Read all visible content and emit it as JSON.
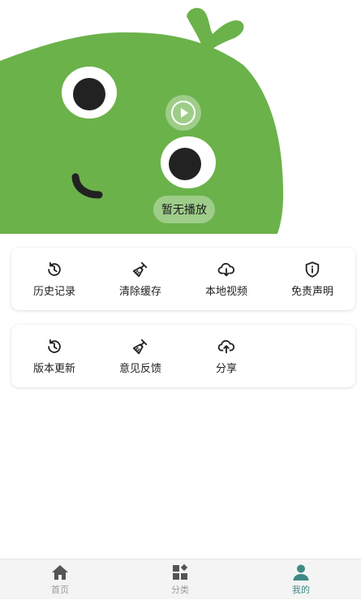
{
  "banner": {
    "play_icon": "play-circle-icon",
    "status_text": "暂无播放",
    "mascot_color": "#6bb24a"
  },
  "menu_card_1": {
    "items": [
      {
        "icon": "history-icon",
        "label": "历史记录"
      },
      {
        "icon": "broom-icon",
        "label": "清除缓存"
      },
      {
        "icon": "cloud-download-icon",
        "label": "本地视频"
      },
      {
        "icon": "shield-info-icon",
        "label": "免责声明"
      }
    ]
  },
  "menu_card_2": {
    "items": [
      {
        "icon": "history-icon",
        "label": "版本更新"
      },
      {
        "icon": "broom-icon",
        "label": "意见反馈"
      },
      {
        "icon": "cloud-upload-icon",
        "label": "分享"
      }
    ]
  },
  "tabbar": {
    "tabs": [
      {
        "icon": "home-icon",
        "label": "首页",
        "active": false
      },
      {
        "icon": "category-icon",
        "label": "分类",
        "active": false
      },
      {
        "icon": "user-icon",
        "label": "我的",
        "active": true
      }
    ],
    "active_color": "#3f8a86",
    "inactive_color": "#9a9a9a"
  }
}
